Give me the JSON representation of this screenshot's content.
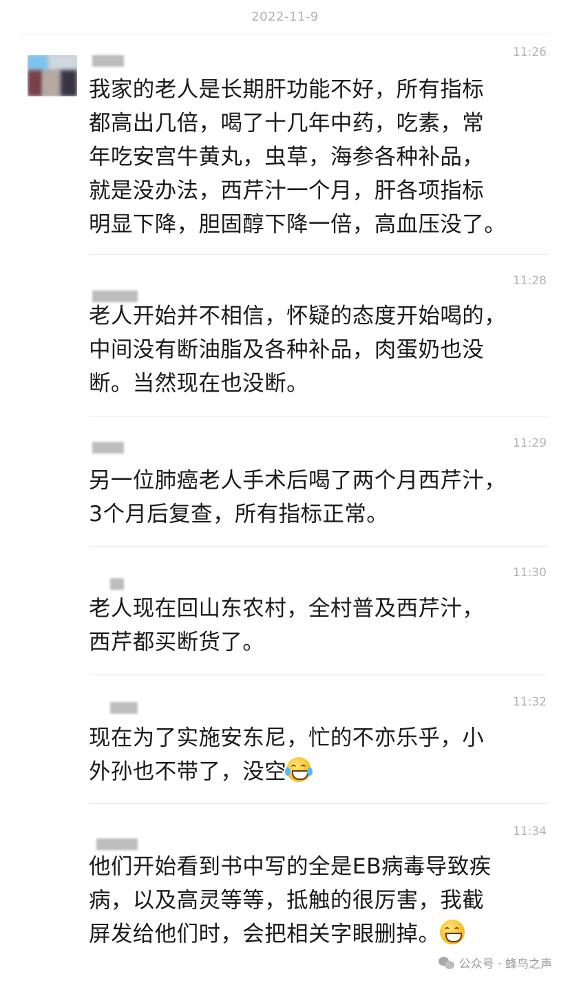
{
  "date_header": "2022-11-9",
  "messages": [
    {
      "time": "11:26",
      "text": "我家的老人是长期肝功能不好，所有指标\n都高出几倍，喝了十几年中药，吃素，常\n年吃安宫牛黄丸，虫草，海参各种补品，\n就是没办法，西芹汁一个月，肝各项指标\n明显下降，胆固醇下降一倍，高血压没了。"
    },
    {
      "time": "11:28",
      "text": "老人开始并不相信，怀疑的态度开始喝的，\n中间没有断油脂及各种补品，肉蛋奶也没\n断。当然现在也没断。"
    },
    {
      "time": "11:29",
      "text": "另一位肺癌老人手术后喝了两个月西芹汁，\n3个月后复查，所有指标正常。"
    },
    {
      "time": "11:30",
      "text": "老人现在回山东农村，全村普及西芹汁，\n西芹都买断货了。"
    },
    {
      "time": "11:32",
      "text": "现在为了实施安东尼，忙的不亦乐乎，小\n外孙也不带了，没空",
      "emoji": "crying-laughing-emoji"
    },
    {
      "time": "11:34",
      "text": "他们开始看到书中写的全是EB病毒导致疾\n病，以及高灵等等，抵触的很厉害，我截\n屏发给他们时，会把相关字眼删掉。",
      "emoji": "grinning-emoji"
    }
  ],
  "watermark": {
    "icon": "wechat-icon",
    "text": "公众号 · 蜂鸟之声"
  }
}
